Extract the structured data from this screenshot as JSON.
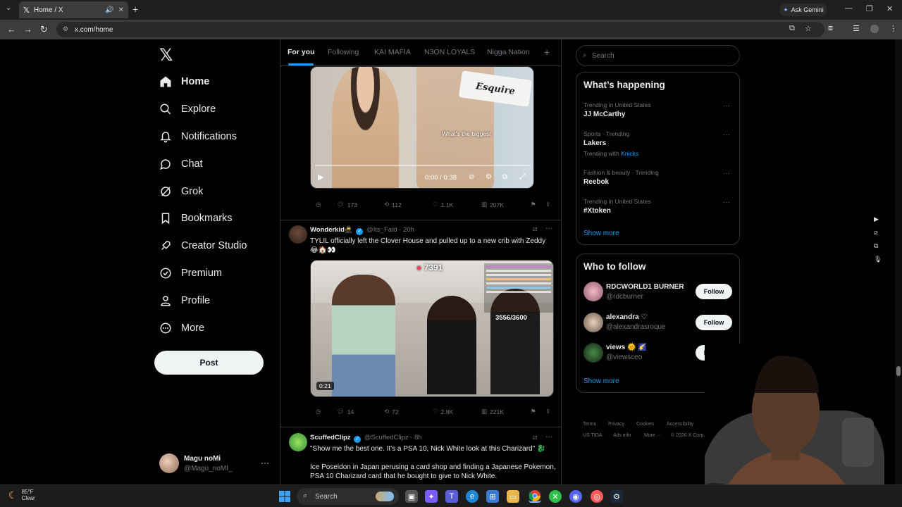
{
  "browser": {
    "tab_title": "Home / X",
    "url": "x.com/home",
    "gemini_label": "Ask Gemini"
  },
  "nav": {
    "items": [
      {
        "label": "Home",
        "icon": "home-icon"
      },
      {
        "label": "Explore",
        "icon": "search-icon"
      },
      {
        "label": "Notifications",
        "icon": "bell-icon"
      },
      {
        "label": "Chat",
        "icon": "chat-icon"
      },
      {
        "label": "Grok",
        "icon": "grok-icon"
      },
      {
        "label": "Bookmarks",
        "icon": "bookmark-icon"
      },
      {
        "label": "Creator Studio",
        "icon": "rocket-icon"
      },
      {
        "label": "Premium",
        "icon": "premium-icon"
      },
      {
        "label": "Profile",
        "icon": "person-icon"
      },
      {
        "label": "More",
        "icon": "more-circle-icon"
      }
    ],
    "post_label": "Post",
    "account": {
      "name": "Magu noMi",
      "handle": "@Magu_noMI_"
    }
  },
  "feed": {
    "tabs": [
      "For you",
      "Following",
      "KAI MAFIA",
      "N3ON LOYALS",
      "Nigga Nation"
    ],
    "post1": {
      "video_caption": "What's the biggest",
      "video_brand": "Esquire",
      "time": "0:00 / 0:38",
      "replies": "173",
      "reposts": "112",
      "likes": "1.1K",
      "views": "207K"
    },
    "post2": {
      "name": "Wonderkid",
      "name_emoji": "🥷",
      "handle": "@Its_Faid",
      "time": "20h",
      "text": "TYLIL officially left the Clover House and pulled up to a new crib with Zeddy",
      "text_emoji": "😂🏠👀",
      "viewer_count": "7391",
      "counter": "3556/3600",
      "duration": "0:21",
      "replies": "14",
      "reposts": "72",
      "likes": "2.8K",
      "views": "221K"
    },
    "post3": {
      "name": "ScuffedClipz",
      "handle": "@ScuffedClipz",
      "time": "8h",
      "text1": "\"Show me the best one. It's a PSA 10, Nick White look at this Charizard\" 🐉",
      "text2": "Ice Poseidon in Japan perusing a card shop and finding a Japanese Pokemon, PSA 10 Charizard card that he bought to give to Nick White."
    }
  },
  "right": {
    "search_placeholder": "Search",
    "happening_title": "What’s happening",
    "trends": [
      {
        "category": "Trending in United States",
        "name": "JJ McCarthy",
        "sub_prefix": "",
        "sub_link": ""
      },
      {
        "category": "Sports · Trending",
        "name": "Lakers",
        "sub_prefix": "Trending with",
        "sub_link": "Knicks"
      },
      {
        "category": "Fashion & beauty · Trending",
        "name": "Reebok",
        "sub_prefix": "",
        "sub_link": ""
      },
      {
        "category": "Trending in United States",
        "name": "#Xtoken",
        "sub_prefix": "",
        "sub_link": ""
      }
    ],
    "show_more": "Show more",
    "wtf_title": "Who to follow",
    "wtf": [
      {
        "name": "RDCWORLD1 BURNER",
        "handle": "@rdcburner"
      },
      {
        "name": "alexandra ♡",
        "handle": "@alexandrasroque"
      },
      {
        "name": "views 🌞 🌠",
        "handle": "@viewsceo"
      }
    ],
    "follow_label": "Follow",
    "footer": [
      "Terms",
      "Privacy",
      "Cookies",
      "Accessibility",
      "US TIDA",
      "Ads info",
      "More ···",
      "© 2026 X Corp."
    ]
  },
  "taskbar": {
    "temp": "85°F",
    "condition": "Clear",
    "search_label": "Search"
  }
}
